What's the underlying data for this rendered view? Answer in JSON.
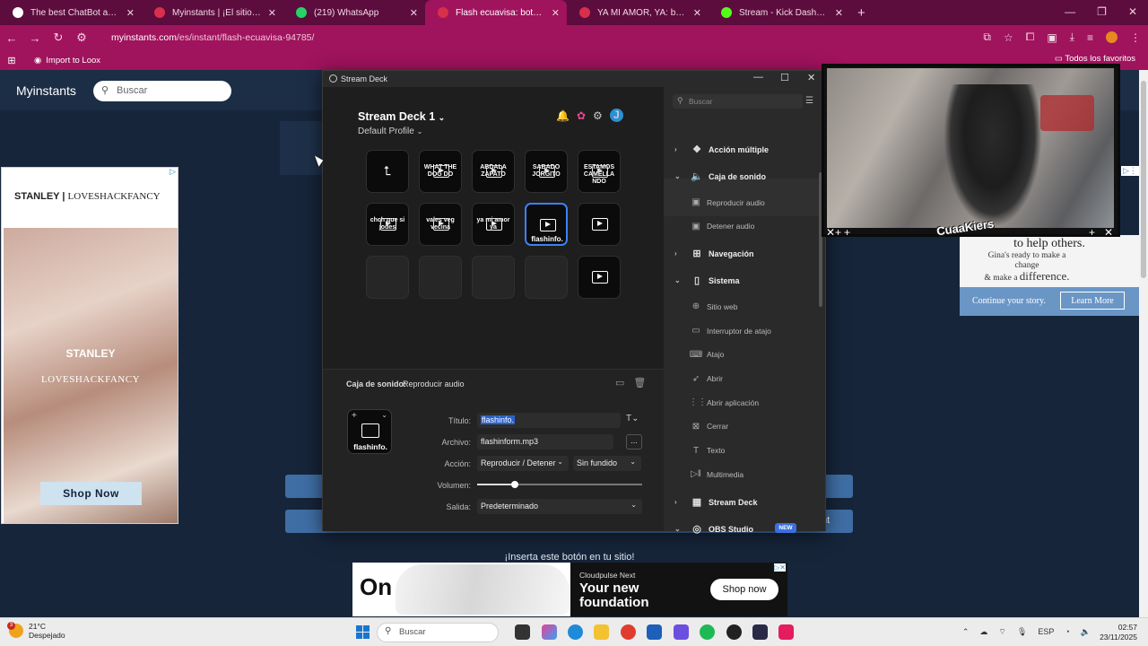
{
  "browser": {
    "tabs": [
      {
        "label": "The best ChatBot and Widgets",
        "icon": "diamond-icon",
        "icon_color": "#ffffff",
        "active": false
      },
      {
        "label": "Myinstants | ¡El sitio web de bo",
        "icon": "myinstants-icon",
        "icon_color": "#d8304a",
        "active": false
      },
      {
        "label": "(219) WhatsApp",
        "icon": "whatsapp-icon",
        "icon_color": "#25d366",
        "active": false
      },
      {
        "label": "Flash ecuavisa: botón de efecto",
        "icon": "myinstants-icon",
        "icon_color": "#d8304a",
        "active": true
      },
      {
        "label": "YA MI AMOR, YA: botón de efec",
        "icon": "myinstants-icon",
        "icon_color": "#d8304a",
        "active": false
      },
      {
        "label": "Stream - Kick Dashboard",
        "icon": "kick-icon",
        "icon_color": "#53fc18",
        "active": false
      }
    ],
    "url_host": "myinstants.com",
    "url_path": "/es/instant/flash-ecuavisa-94785/",
    "bookmark": "Import to Loox",
    "all_bookmarks": "Todos los favoritos",
    "accent": "#a0135d"
  },
  "site": {
    "logo": "Myinstants",
    "search_placeholder": "Buscar",
    "insert_text": "¡Inserta este botón en tu sitio!",
    "button_partial_right": "nt"
  },
  "ads": {
    "left": {
      "brand": "STANLEY",
      "partner": "LOVESHACKFANCY",
      "brand_mid": "STANLEY",
      "partner_mid": "LOVESHACKFANCY",
      "cta": "Shop Now"
    },
    "right": {
      "headline": "to help others.",
      "sub_1": "Gina's ready to make a change",
      "sub_2": "& make a",
      "sub_3": "difference.",
      "continue": "Continue your story.",
      "cta": "Learn More"
    },
    "bottom": {
      "logo": "On",
      "brand": "Cloudpulse Next",
      "headline_1": "Your new",
      "headline_2": "foundation",
      "cta": "Shop now"
    }
  },
  "streamdeck": {
    "window_title": "Stream Deck",
    "deck_name": "Stream Deck 1",
    "profile": "Default Profile",
    "user_initial": "J",
    "keys": [
      {
        "type": "back"
      },
      {
        "type": "audio",
        "label": "WHAT THE DOG DO"
      },
      {
        "type": "audio",
        "label": "ABDALA ZAPATO"
      },
      {
        "type": "audio",
        "label": "SABADO JORGITO"
      },
      {
        "type": "audio",
        "label": "ESTAMOS CAMELLA NDO"
      },
      {
        "type": "audio",
        "label": "chch que si jodes"
      },
      {
        "type": "audio",
        "label": "vales veg vecina"
      },
      {
        "type": "audio",
        "label": "ya mi amor ya"
      },
      {
        "type": "audio",
        "label": "",
        "bottom": "flashinfo.",
        "selected": true
      },
      {
        "type": "audio",
        "label": ""
      },
      {
        "type": "empty"
      },
      {
        "type": "empty"
      },
      {
        "type": "empty"
      },
      {
        "type": "empty"
      },
      {
        "type": "audio",
        "label": ""
      }
    ],
    "inspector": {
      "category": "Caja de sonido:",
      "action": "Reproducir audio",
      "preview_label": "flashinfo.",
      "fields": {
        "title_label": "Título:",
        "title_value": "flashinfo.",
        "file_label": "Archivo:",
        "file_value": "flashinform.mp3",
        "browse": "...",
        "action_label": "Acción:",
        "action_value": "Reproducir / Detener",
        "fade_value": "Sin fundido",
        "volume_label": "Volumen:",
        "volume_value": 0.23,
        "output_label": "Salida:",
        "output_value": "Predeterminado"
      }
    },
    "sidebar": {
      "search_placeholder": "Buscar",
      "categories": [
        {
          "label": "Acción múltiple",
          "icon": "multi-action-icon",
          "expanded": false,
          "items": []
        },
        {
          "label": "Caja de sonido",
          "icon": "speaker-icon",
          "expanded": true,
          "items": [
            {
              "label": "Reproducir audio",
              "icon": "play-audio-icon"
            },
            {
              "label": "Detener audio",
              "icon": "stop-audio-icon"
            }
          ]
        },
        {
          "label": "Navegación",
          "icon": "navigation-icon",
          "expanded": false,
          "items": []
        },
        {
          "label": "Sistema",
          "icon": "phone-icon",
          "expanded": true,
          "items": [
            {
              "label": "Sitio web",
              "icon": "globe-icon"
            },
            {
              "label": "Interruptor de atajo",
              "icon": "toggle-icon"
            },
            {
              "label": "Atajo",
              "icon": "keyboard-icon"
            },
            {
              "label": "Abrir",
              "icon": "rocket-icon"
            },
            {
              "label": "Abrir aplicación",
              "icon": "grid-icon"
            },
            {
              "label": "Cerrar",
              "icon": "close-window-icon"
            },
            {
              "label": "Texto",
              "icon": "text-icon"
            },
            {
              "label": "Multimedia",
              "icon": "media-icon"
            }
          ]
        },
        {
          "label": "Stream Deck",
          "icon": "streamdeck-icon",
          "expanded": false,
          "items": []
        },
        {
          "label": "OBS Studio",
          "icon": "obs-icon",
          "expanded": true,
          "badge": "NEW",
          "items": []
        }
      ]
    }
  },
  "webcam": {
    "overlay_text": "CuaaKiers"
  },
  "taskbar": {
    "temperature": "21°C",
    "condition": "Despejado",
    "weather_badge": "3",
    "search_placeholder": "Buscar",
    "language": "ESP",
    "time": "02:57",
    "date": "23/11/2025"
  }
}
